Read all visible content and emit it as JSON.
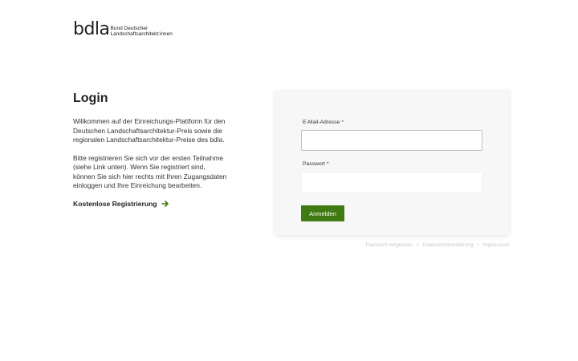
{
  "logo": {
    "mark": "bdla",
    "line1": "Bund Deutscher",
    "line2": "Landschaftsarchitekt:innen"
  },
  "login": {
    "title": "Login",
    "intro": "Willkommen auf der Einreichungs-Plattform für den Deutschen Landschaftsarchitektur-Preis sowie die regionalen Landschaftsarchitektur-Preise des bdla.",
    "info": "Bitte registrieren Sie sich vor der ersten Teilnahme (siehe Link unten). Wenn Sie registriert sind, können Sie sich hier rechts mit Ihren Zugangsdaten einloggen und Ihre Einreichung bearbeiten.",
    "register_link": "Kostenlose Registrierung"
  },
  "form": {
    "email_label": "E-Mail-Adresse *",
    "email_value": "",
    "password_label": "Passwort *",
    "password_value": "",
    "submit_label": "Anmelden"
  },
  "footer": {
    "forgot": "Passwort vergessen",
    "privacy": "Datenschutzerklärung",
    "imprint": "Impressum",
    "separator": "•"
  },
  "colors": {
    "accent": "#3f7a12",
    "link_muted": "#c8c8c8"
  }
}
